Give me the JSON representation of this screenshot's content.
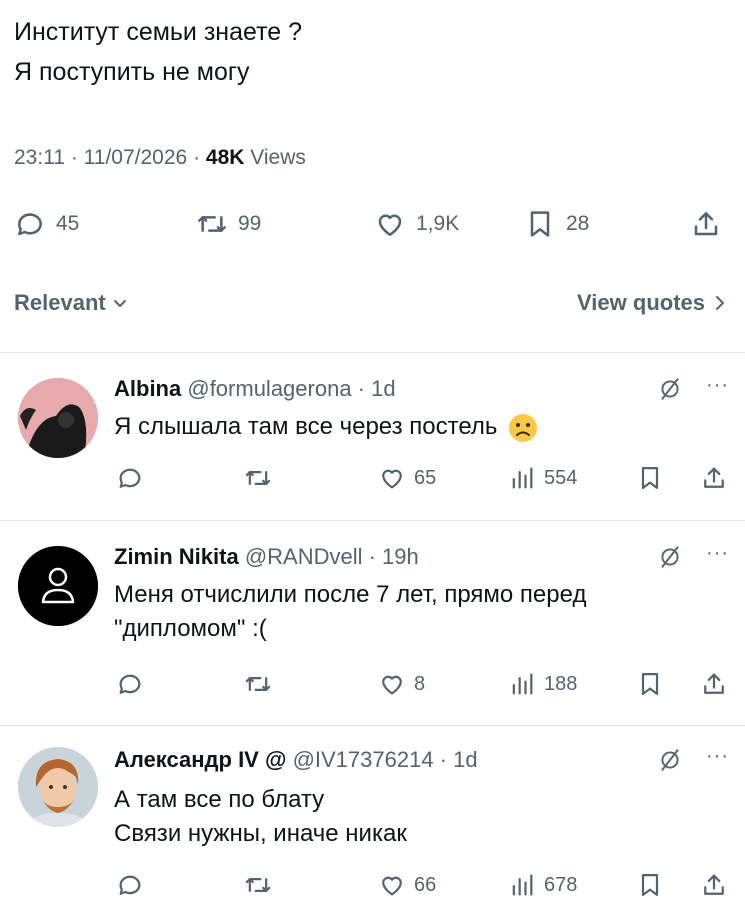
{
  "tweet": {
    "lines": [
      "Институт семьи знаете ?",
      "Я поступить не могу"
    ],
    "time": "23:11",
    "date": "11/07/2026",
    "views_count": "48K",
    "views_label": "Views"
  },
  "actions": {
    "replies": "45",
    "reposts": "99",
    "likes": "1,9K",
    "bookmarks": "28"
  },
  "sort": {
    "left_label": "Relevant",
    "right_label": "View quotes"
  },
  "replies": [
    {
      "name": "Albina",
      "handle": "@formulagerona · 1d",
      "text": "Я слышала там все через постель",
      "likes": "65",
      "views": "554"
    },
    {
      "name": "Zimin Nikita",
      "handle": "@RANDvell · 19h",
      "text": "Меня отчислили после 7 лет, прямо перед \"дипломом\" :(",
      "likes": "8",
      "views": "188"
    },
    {
      "name": "Александр IV @",
      "handle": "@IV17376214 · 1d",
      "text": "А там все по блату\nСвязи нужны, иначе никак",
      "likes": "66",
      "views": "678"
    }
  ],
  "colors": {
    "text": "#0f1419",
    "secondary": "#536471",
    "divider": "#e6e9eb",
    "emoji": "#f9c846"
  }
}
